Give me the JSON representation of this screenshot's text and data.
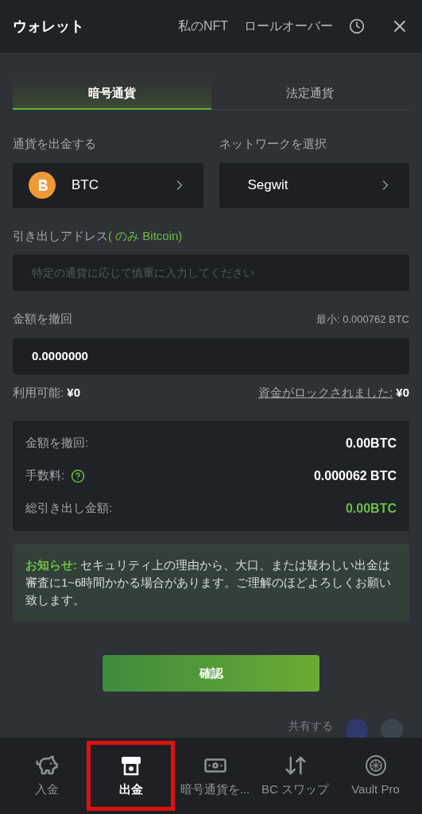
{
  "header": {
    "title": "ウォレット",
    "links": [
      "私のNFT",
      "ロールオーバー"
    ]
  },
  "tabs": [
    {
      "label": "暗号通貨",
      "selected": true
    },
    {
      "label": "法定通貨",
      "selected": false
    }
  ],
  "currency": {
    "label": "通貨を出金する",
    "value": "BTC"
  },
  "network": {
    "label": "ネットワークを選択",
    "value": "Segwit"
  },
  "address": {
    "label": "引き出しアドレス",
    "note": "( のみ Bitcoin)",
    "placeholder": "特定の通貨に応じて慎重に入力してください"
  },
  "amount": {
    "label": "金額を撤回",
    "min": "最小: 0.000762 BTC",
    "value": "0.0000000",
    "available_label": "利用可能:",
    "available": "¥0",
    "locked_label": "資金がロックされました:",
    "locked": "¥0"
  },
  "summary": [
    {
      "label": "金額を撤回:",
      "value": "0.00BTC",
      "help": false,
      "highlight": false
    },
    {
      "label": "手数料:",
      "value": "0.000062 BTC",
      "help": true,
      "highlight": false
    },
    {
      "label": "総引き出し金額:",
      "value": "0.00BTC",
      "help": false,
      "highlight": true
    }
  ],
  "notice": "**お知らせ:** セキュリティ上の理由から、大口、または疑わしい出金は審査に1~6時間かかる場合があります。ご理解のほどよろしくお願い致します。",
  "confirm": "確認",
  "share": "共有する",
  "nav": [
    {
      "label": "入金",
      "kind": "piggy",
      "selected": false
    },
    {
      "label": "出金",
      "kind": "atm",
      "selected": true
    },
    {
      "label": "暗号通貨を...",
      "kind": "cash",
      "selected": false
    },
    {
      "label": "BC スワップ",
      "kind": "swap",
      "selected": false
    },
    {
      "label": "Vault Pro",
      "kind": "vault",
      "selected": false
    }
  ]
}
